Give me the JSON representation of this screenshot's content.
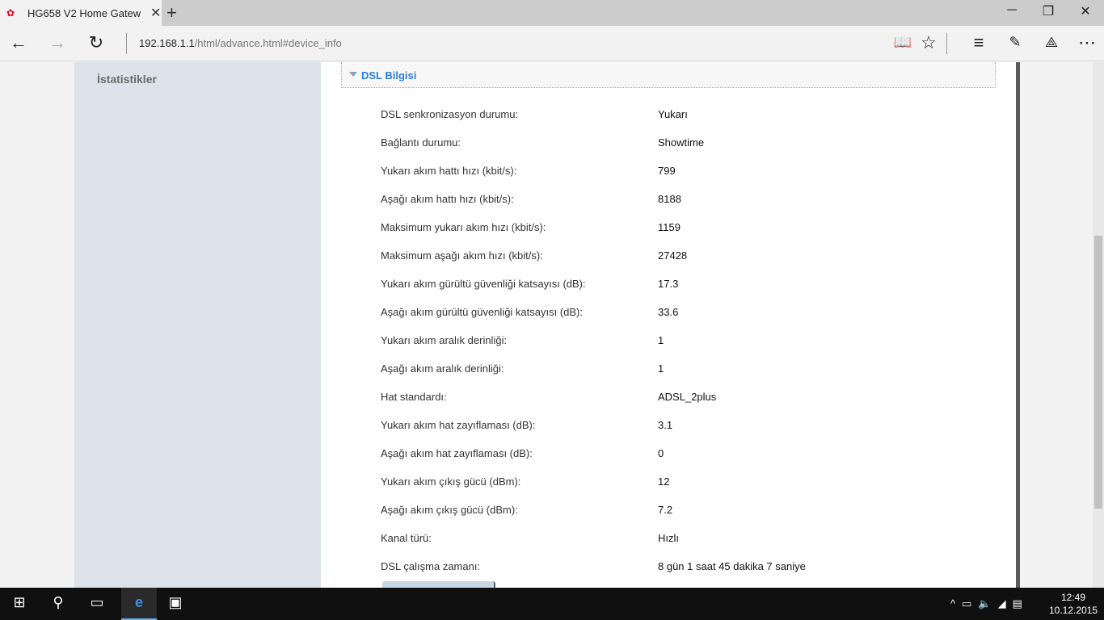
{
  "browser": {
    "tab_title": "HG658 V2 Home Gatew",
    "url_host": "192.168.1.1",
    "url_path": "/html/advance.html#device_info"
  },
  "sidebar": {
    "item": "İstatistikler"
  },
  "section": {
    "title": "DSL Bilgisi"
  },
  "rows": [
    {
      "label": "DSL senkronizasyon durumu:",
      "value": "Yukarı"
    },
    {
      "label": "Bağlantı durumu:",
      "value": "Showtime"
    },
    {
      "label": "Yukarı akım hattı hızı (kbit/s):",
      "value": "799"
    },
    {
      "label": "Aşağı akım hattı hızı (kbit/s):",
      "value": "8188"
    },
    {
      "label": "Maksimum yukarı akım hızı (kbit/s):",
      "value": "1159"
    },
    {
      "label": "Maksimum aşağı akım hızı (kbit/s):",
      "value": "27428"
    },
    {
      "label": "Yukarı akım gürültü güvenliği katsayısı (dB):",
      "value": "17.3"
    },
    {
      "label": "Aşağı akım gürültü güvenliği katsayısı (dB):",
      "value": "33.6"
    },
    {
      "label": "Yukarı akım aralık derinliği:",
      "value": "1"
    },
    {
      "label": "Aşağı akım aralık derinliği:",
      "value": "1"
    },
    {
      "label": "Hat standardı:",
      "value": "ADSL_2plus"
    },
    {
      "label": "Yukarı akım hat zayıflaması (dB):",
      "value": "3.1"
    },
    {
      "label": "Aşağı akım hat zayıflaması (dB):",
      "value": "0"
    },
    {
      "label": "Yukarı akım çıkış gücü (dBm):",
      "value": "12"
    },
    {
      "label": "Aşağı akım çıkış gücü (dBm):",
      "value": "7.2"
    },
    {
      "label": "Kanal türü:",
      "value": "Hızlı"
    },
    {
      "label": "DSL çalışma zamanı:",
      "value": "8 gün 1 saat 45 dakika 7 saniye"
    }
  ],
  "taskbar": {
    "time": "12:49",
    "date": "10.12.2015"
  }
}
